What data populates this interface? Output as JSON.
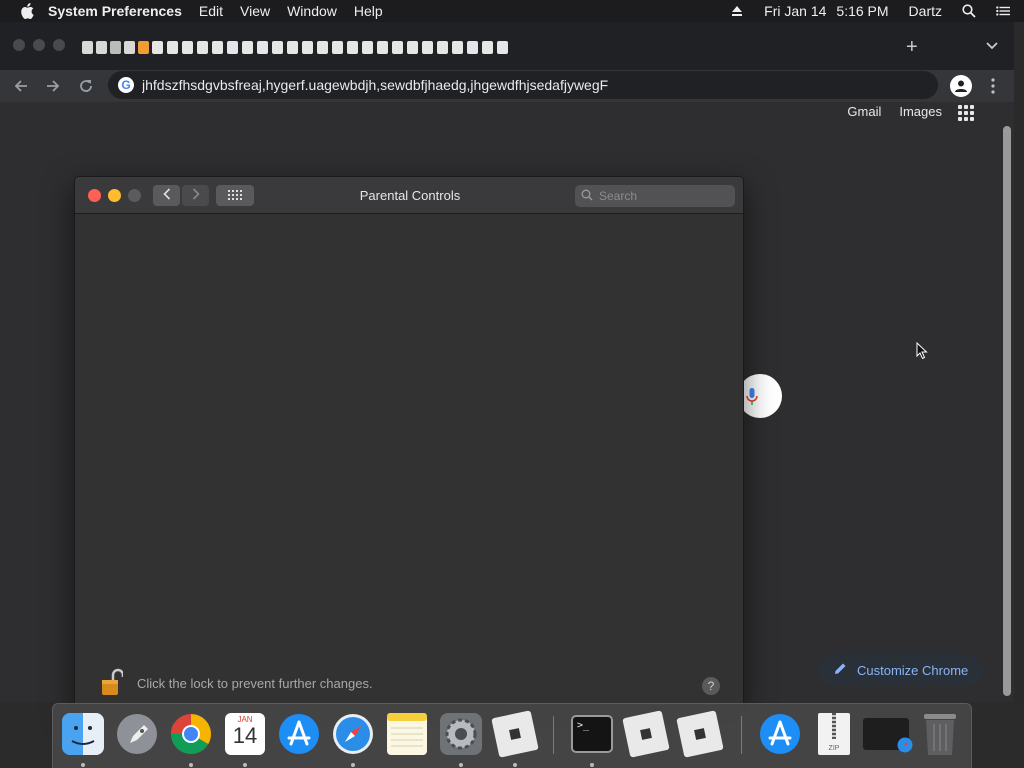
{
  "menubar": {
    "app_name": "System Preferences",
    "items": [
      "Edit",
      "View",
      "Window",
      "Help"
    ],
    "date": "Fri Jan 14",
    "time": "5:16 PM",
    "user": "Dartz"
  },
  "browser": {
    "url": "jhfdszfhsdgvbsfreaj,hygerf.uagewbdjh,sewdbfjhaedg,jhgewdfhjsedafjywegF",
    "header_links": [
      "Gmail",
      "Images"
    ],
    "customize_label": "Customize Chrome"
  },
  "prefs_window": {
    "title": "Parental Controls",
    "search_placeholder": "Search",
    "lock_text": "Click the lock to prevent further changes.",
    "help_label": "?"
  },
  "dock": {
    "calendar_month": "JAN",
    "calendar_day": "14",
    "terminal_prompt": ">_",
    "zip_label": "ZIP"
  },
  "colors": {
    "close": "#ff5f57",
    "minimize": "#febc2e",
    "zoom_inactive": "#5b5b5d",
    "accent_blue": "#8ab4f8"
  }
}
